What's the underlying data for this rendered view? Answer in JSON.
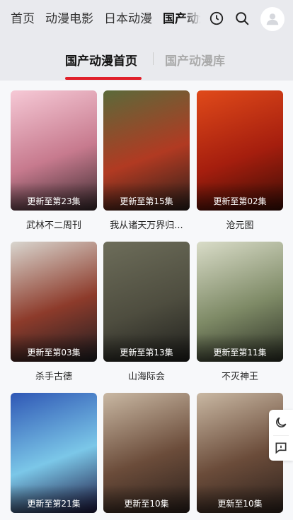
{
  "nav": {
    "items": [
      "首页",
      "动漫电影",
      "日本动漫",
      "国产动漫"
    ],
    "active_index": 3
  },
  "header_icons": [
    "history-icon",
    "search-icon",
    "user-avatar-icon"
  ],
  "subtabs": {
    "active": "国产动漫首页",
    "other": "国产动漫库"
  },
  "cards": [
    {
      "title": "武林不二周刊",
      "badge": "更新至第23集",
      "colors": [
        "#f6c9d6",
        "#c77a8e",
        "#3a2a2e"
      ]
    },
    {
      "title": "我从诸天万界归...",
      "badge": "更新至第15集",
      "colors": [
        "#5a6a3a",
        "#b13a22",
        "#2a1f1a"
      ]
    },
    {
      "title": "沧元图",
      "badge": "更新至第02集",
      "colors": [
        "#e04a1a",
        "#a51e0e",
        "#3a0d05"
      ]
    },
    {
      "title": "杀手古德",
      "badge": "更新至第03集",
      "colors": [
        "#d9d6cf",
        "#8d3b2b",
        "#1e1e22"
      ]
    },
    {
      "title": "山海际会",
      "badge": "更新至第13集",
      "colors": [
        "#6d6d5a",
        "#4e4d3f",
        "#1f1f1c"
      ]
    },
    {
      "title": "不灭神王",
      "badge": "更新至第11集",
      "colors": [
        "#d9dcc8",
        "#7e8a66",
        "#2b2f24"
      ]
    },
    {
      "title": "",
      "badge": "更新至第21集",
      "colors": [
        "#2f57b5",
        "#7bc7e8",
        "#1b1640"
      ]
    },
    {
      "title": "",
      "badge": "更新至10集",
      "colors": [
        "#c9b8a3",
        "#6b4c3a",
        "#2c211c"
      ]
    },
    {
      "title": "",
      "badge": "更新至10集",
      "colors": [
        "#c9b8a3",
        "#6b4c3a",
        "#2c211c"
      ]
    }
  ],
  "float_icons": [
    "dark-mode-icon",
    "feedback-icon"
  ],
  "accent": "#e0202a"
}
